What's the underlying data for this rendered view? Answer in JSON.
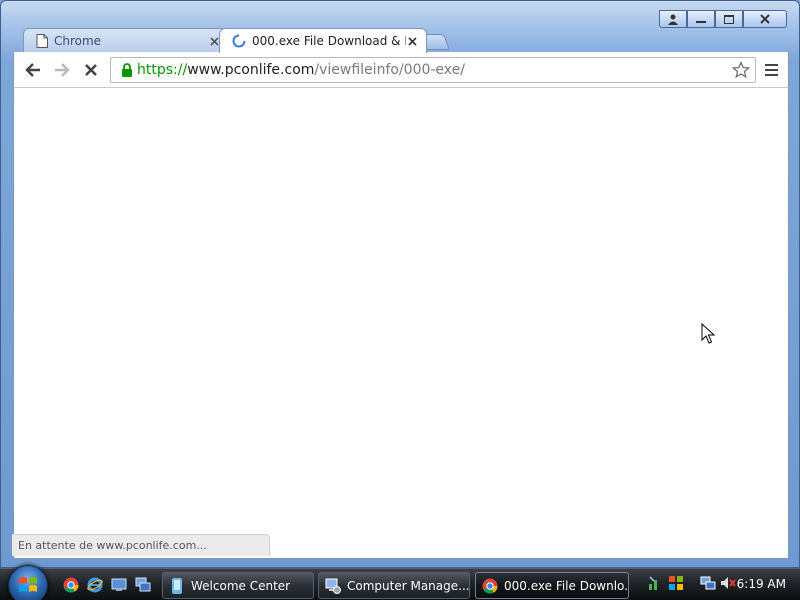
{
  "tabs": [
    {
      "title": "Chrome",
      "state": "inactive",
      "icon": "page-icon"
    },
    {
      "title": "000.exe File Download & F",
      "state": "active-loading",
      "icon": "loading-spinner-icon"
    }
  ],
  "address_bar": {
    "scheme": "https://",
    "host": "www.pconlife.com",
    "path": "/viewfileinfo/000-exe/",
    "secure": true
  },
  "status_bar": {
    "text": "En attente de www.pconlife.com..."
  },
  "taskbar": {
    "quick_launch": [
      "chrome-icon",
      "internet-explorer-icon",
      "show-desktop-icon",
      "switch-windows-icon"
    ],
    "buttons": [
      {
        "label": "Welcome Center",
        "icon": "welcome-center-icon",
        "active": false
      },
      {
        "label": "Computer Manage...",
        "icon": "computer-management-icon",
        "active": false
      },
      {
        "label": "000.exe File Downlo...",
        "icon": "chrome-icon",
        "active": true
      }
    ],
    "tray_icons": [
      "network-icon",
      "security-center-icon",
      "network-status-icon",
      "volume-muted-icon"
    ],
    "clock": "6:19 AM"
  },
  "colors": {
    "secure_scheme": "#079500",
    "window_frame": "#7ea6d8",
    "taskbar": "#202428"
  }
}
